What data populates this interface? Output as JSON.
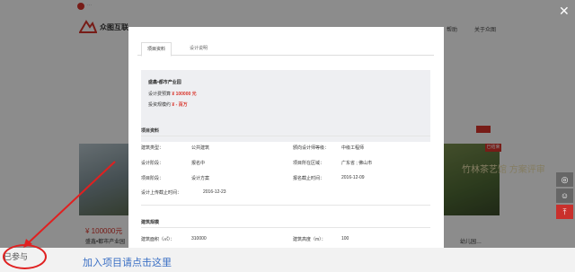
{
  "background": {
    "brand_name": "众图互联",
    "nav_right": [
      "帮助",
      "关于众图"
    ],
    "left_price": "¥ 100000元",
    "left_title": "盛鑫•都市产业园",
    "right_promo": "竹林茶艺馆 方案评审",
    "right_badge": "已结束",
    "right_title": "幼儿园…"
  },
  "modal": {
    "tabs": [
      "项目资料",
      "设计说明"
    ],
    "summary": {
      "title": "盛鑫•都市产业园",
      "rows": [
        {
          "label": "设计费预算",
          "value": "¥ 100000 元"
        },
        {
          "label": "投资规模约",
          "value": "¥ - 百万"
        }
      ]
    },
    "section1_title": "项目资料",
    "fields": [
      {
        "label": "建筑类型：",
        "value": "公共建筑",
        "label2": "颁向设计师等级：",
        "value2": "中级工程师"
      },
      {
        "label": "设计阶段：",
        "value": "报名中",
        "label2": "项目所在区域：",
        "value2": "广东省 ; 佛山市"
      },
      {
        "label": "项目阶段：",
        "value": "设计方案",
        "label2": "报名截止时间：",
        "value2": "2016-12-09"
      },
      {
        "label": "设计上传截止时间：",
        "value": "2016-12-23",
        "label2": "",
        "value2": ""
      }
    ],
    "section2_title": "建筑规模",
    "scale": {
      "label": "建筑面积（㎡）：",
      "value": "310000",
      "label2": "建筑高度（m）：",
      "value2": "100"
    }
  },
  "bottom": {
    "badge": "已参与",
    "link": "加入项目请点击这里"
  },
  "colors": {
    "accent": "#d9342b",
    "link": "#3a6fc4",
    "annotation": "#e02020"
  }
}
